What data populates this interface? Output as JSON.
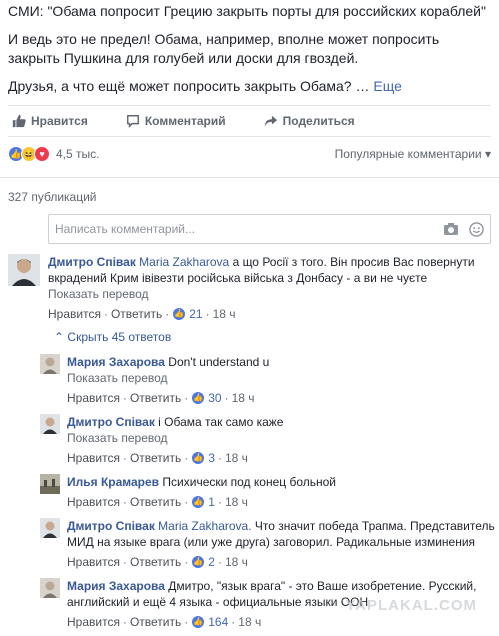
{
  "post": {
    "lines": [
      "СМИ: \"Обама попросит Грецию закрыть порты для российских кораблей\"",
      "И ведь это не предел! Обама, например, вполне может попросить закрыть Пушкина для голубей или доски для гвоздей.",
      "Друзья, а что ещё может попросить закрыть Обама?"
    ],
    "see_more": "Еще"
  },
  "actions": {
    "like": "Нравится",
    "comment": "Комментарий",
    "share": "Поделиться"
  },
  "reactions": {
    "count": "4,5 тыс.",
    "sort": "Популярные комментарии"
  },
  "publications": "327 публикаций",
  "composer": {
    "placeholder": "Написать комментарий..."
  },
  "labels": {
    "like": "Нравится",
    "reply": "Ответить",
    "translate": "Показать перевод",
    "hide_replies": "Скрыть 45 ответов"
  },
  "comment": {
    "author": "Дмитро Співак",
    "mention": "Maria Zakharova",
    "text": "а що Росії з того. Він просив Вас повернути вкрадений Крим івівезти російська війська з Донбасу - а ви не чуєте",
    "likes": "21",
    "time": "18 ч"
  },
  "replies": [
    {
      "author": "Мария Захарова",
      "mention": "",
      "text": "Don't understand u",
      "translate": true,
      "likes": "30",
      "time": "18 ч"
    },
    {
      "author": "Дмитро Співак",
      "mention": "",
      "text": "і Обама так само каже",
      "translate": true,
      "likes": "3",
      "time": "18 ч"
    },
    {
      "author": "Илья Крамарев",
      "mention": "",
      "text": "Психически под конец больной",
      "translate": false,
      "likes": "1",
      "time": "18 ч"
    },
    {
      "author": "Дмитро Співак",
      "mention": "Maria Zakharova.",
      "text": "Что значит победа Трапма. Представитель МИД на языке врага (или уже друга) заговорил. Радикальные изминения",
      "translate": false,
      "likes": "2",
      "time": "18 ч"
    },
    {
      "author": "Мария Захарова",
      "mention": "",
      "text": "Дмитро, \"язык врага\" - это Ваше изобретение. Русский, английский и ещё 4 языка - официальные языки ООН",
      "translate": false,
      "likes": "164",
      "time": "18 ч"
    }
  ],
  "watermark": "YAPLAKAL.COM",
  "colors": {
    "link": "#385898",
    "like_blue": "#4a76e8",
    "muted": "#606770"
  }
}
